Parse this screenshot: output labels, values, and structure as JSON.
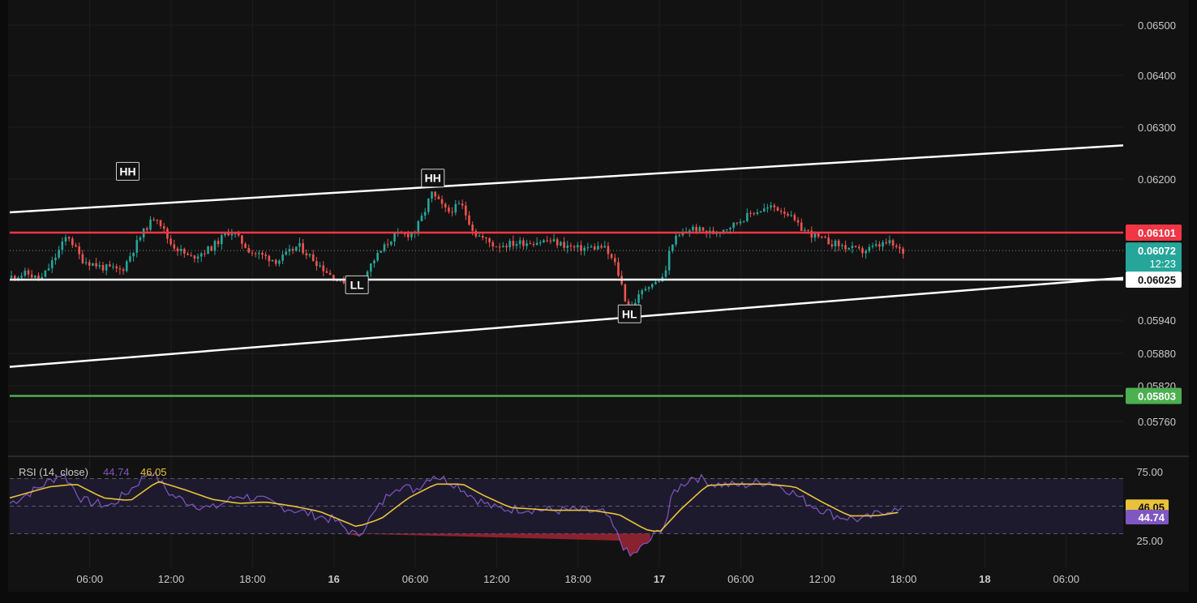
{
  "colors": {
    "background": "#121212",
    "frame": "#0b0b0b",
    "grid": "#1f1f1f",
    "text": "#c9c9c9",
    "up": "#26a69a",
    "down": "#ef5350",
    "resistance": "#f23645",
    "support_green": "#4caf50",
    "channel": "#ffffff",
    "rsi_line": "#7e57c2",
    "rsi_ma": "#e8c33a",
    "rsi_band": "#1e1a2e"
  },
  "chart_data": [
    {
      "type": "candlestick",
      "interval_minutes": 15,
      "y_axis": {
        "ticks": [
          "0.06500",
          "0.06400",
          "0.06300",
          "0.06200",
          "0.05940",
          "0.05880",
          "0.05820",
          "0.05760"
        ],
        "tick_values": [
          0.065,
          0.064,
          0.063,
          0.062,
          0.0594,
          0.0588,
          0.0582,
          0.0576
        ],
        "range": [
          0.0572,
          0.0653
        ],
        "scale": "non-linear as displayed"
      },
      "x_axis": {
        "ticks": [
          "06:00",
          "12:00",
          "18:00",
          "16",
          "06:00",
          "12:00",
          "18:00",
          "17",
          "06:00",
          "12:00",
          "18:00",
          "18",
          "06:00"
        ],
        "tick_hours": [
          6,
          12,
          18,
          24,
          30,
          36,
          42,
          48,
          54,
          60,
          66,
          72,
          78
        ],
        "range_hours": [
          0.1,
          82.2
        ]
      },
      "price_labels": {
        "resistance": "0.06101",
        "last": "0.06072",
        "countdown": "12:23",
        "support": "0.06025",
        "green": "0.05803"
      },
      "horizontal_lines": [
        {
          "price": 0.06101,
          "style": "red"
        },
        {
          "price": 0.06025,
          "style": "white"
        },
        {
          "price": 0.05803,
          "style": "green"
        },
        {
          "price": 0.06072,
          "style": "dotted"
        }
      ],
      "trend_lines": [
        {
          "from": {
            "hour": 0.1,
            "price": 0.0614
          },
          "to": {
            "hour": 82.2,
            "price": 0.06265
          }
        },
        {
          "from": {
            "hour": 0.1,
            "price": 0.05855
          },
          "to": {
            "hour": 82.2,
            "price": 0.06028
          }
        }
      ],
      "annotations": [
        {
          "text": "HH",
          "hour": 8.8,
          "price": 0.06215
        },
        {
          "text": "LL",
          "hour": 25.7,
          "price": 0.06005
        },
        {
          "text": "HH",
          "hour": 31.3,
          "price": 0.06202
        },
        {
          "text": "HL",
          "hour": 45.8,
          "price": 0.05951
        }
      ],
      "series_path": [
        [
          0.1,
          0.06028
        ],
        [
          1.5,
          0.06035
        ],
        [
          2.5,
          0.06024
        ],
        [
          3.5,
          0.06058
        ],
        [
          4.5,
          0.06098
        ],
        [
          5.5,
          0.06058
        ],
        [
          7,
          0.06045
        ],
        [
          8.5,
          0.0604
        ],
        [
          10,
          0.061
        ],
        [
          11,
          0.06135
        ],
        [
          12,
          0.06085
        ],
        [
          13.5,
          0.0606
        ],
        [
          15,
          0.06075
        ],
        [
          16.5,
          0.06105
        ],
        [
          18,
          0.0607
        ],
        [
          20,
          0.06055
        ],
        [
          21.5,
          0.0608
        ],
        [
          23,
          0.0605
        ],
        [
          24.5,
          0.0602
        ],
        [
          25.7,
          0.06005
        ],
        [
          27,
          0.06055
        ],
        [
          28.5,
          0.06095
        ],
        [
          30,
          0.061
        ],
        [
          30.8,
          0.0614
        ],
        [
          31.3,
          0.06175
        ],
        [
          32.5,
          0.0614
        ],
        [
          33.5,
          0.06155
        ],
        [
          34.5,
          0.061
        ],
        [
          36,
          0.0608
        ],
        [
          38,
          0.06085
        ],
        [
          40,
          0.06088
        ],
        [
          42,
          0.06075
        ],
        [
          44,
          0.06078
        ],
        [
          45,
          0.06045
        ],
        [
          45.8,
          0.05955
        ],
        [
          47,
          0.05995
        ],
        [
          48.5,
          0.0603
        ],
        [
          49,
          0.06085
        ],
        [
          50.5,
          0.0611
        ],
        [
          52,
          0.061
        ],
        [
          53.5,
          0.06115
        ],
        [
          55,
          0.0614
        ],
        [
          56.5,
          0.0615
        ],
        [
          57.5,
          0.0614
        ],
        [
          58.5,
          0.0611
        ],
        [
          60,
          0.0609
        ],
        [
          61.5,
          0.0608
        ],
        [
          63,
          0.0607
        ],
        [
          65,
          0.06085
        ],
        [
          66,
          0.0607
        ]
      ],
      "candle_count": 264
    },
    {
      "type": "line",
      "title": "RSI (14, close)",
      "series": [
        {
          "name": "RSI",
          "last_value": "44.74"
        },
        {
          "name": "MA",
          "last_value": "46.05"
        }
      ],
      "y_axis": {
        "ticks": [
          "75.00",
          "25.00"
        ],
        "tick_values": [
          75,
          25
        ],
        "range": [
          8,
          92
        ]
      },
      "bands": [
        70,
        50,
        30
      ],
      "rsi_path": [
        [
          0.1,
          52
        ],
        [
          2,
          62
        ],
        [
          4,
          74
        ],
        [
          5.5,
          54
        ],
        [
          7.5,
          50
        ],
        [
          9,
          62
        ],
        [
          10.5,
          76
        ],
        [
          12,
          58
        ],
        [
          13.5,
          52
        ],
        [
          15,
          48
        ],
        [
          17,
          58
        ],
        [
          18.5,
          55
        ],
        [
          20,
          50
        ],
        [
          22,
          45
        ],
        [
          24,
          40
        ],
        [
          25.7,
          28
        ],
        [
          27,
          45
        ],
        [
          28.5,
          65
        ],
        [
          30,
          62
        ],
        [
          31.3,
          73
        ],
        [
          33,
          66
        ],
        [
          34.5,
          55
        ],
        [
          36,
          48
        ],
        [
          38,
          48
        ],
        [
          40,
          47
        ],
        [
          42,
          47
        ],
        [
          44,
          45
        ],
        [
          45.8,
          13
        ],
        [
          47,
          22
        ],
        [
          48.5,
          38
        ],
        [
          49,
          60
        ],
        [
          50.5,
          72
        ],
        [
          52,
          66
        ],
        [
          54,
          65
        ],
        [
          56,
          68
        ],
        [
          57.5,
          62
        ],
        [
          59,
          52
        ],
        [
          61,
          43
        ],
        [
          63,
          40
        ],
        [
          65,
          48
        ],
        [
          66,
          45
        ]
      ],
      "ma_path": [
        [
          0.1,
          56
        ],
        [
          3,
          64
        ],
        [
          5,
          66
        ],
        [
          7,
          56
        ],
        [
          9,
          54
        ],
        [
          11,
          68
        ],
        [
          13,
          62
        ],
        [
          15,
          55
        ],
        [
          17,
          52
        ],
        [
          19,
          53
        ],
        [
          21,
          50
        ],
        [
          23,
          46
        ],
        [
          25.7,
          35
        ],
        [
          27.5,
          41
        ],
        [
          29.5,
          56
        ],
        [
          31.5,
          66
        ],
        [
          33.5,
          66
        ],
        [
          35,
          58
        ],
        [
          37,
          49
        ],
        [
          40,
          47
        ],
        [
          43,
          47
        ],
        [
          45,
          44
        ],
        [
          47,
          33
        ],
        [
          48,
          31
        ],
        [
          49.5,
          47
        ],
        [
          51.5,
          65
        ],
        [
          53.5,
          66
        ],
        [
          56,
          66
        ],
        [
          58,
          64
        ],
        [
          60,
          53
        ],
        [
          62,
          43
        ],
        [
          64,
          43
        ],
        [
          66,
          46
        ]
      ]
    }
  ]
}
